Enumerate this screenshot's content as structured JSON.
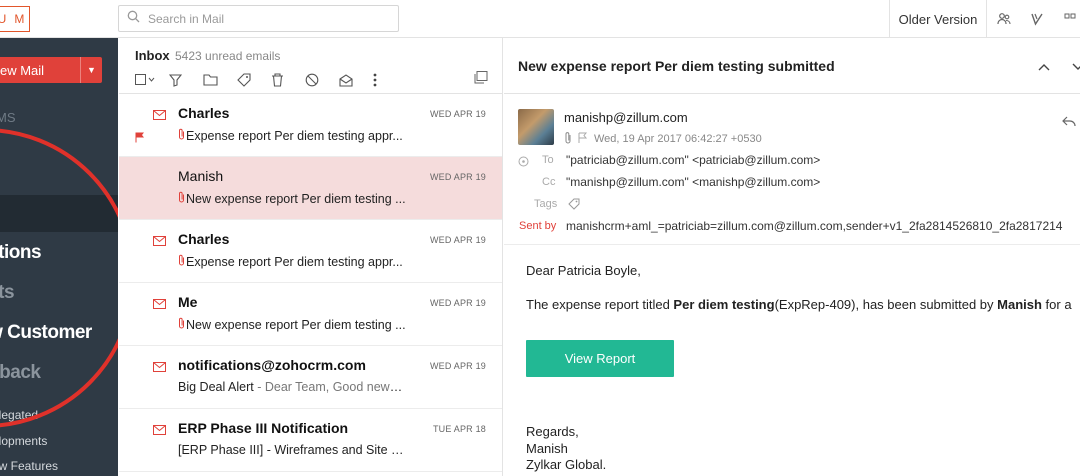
{
  "topbar": {
    "logo_letters": [
      "U",
      "M"
    ],
    "search_placeholder": "Search in Mail",
    "older_version": "Older Version"
  },
  "sidebar": {
    "new_mail": "ew Mail",
    "faded_item": "MS",
    "big_items": [
      "cations",
      "ects",
      "ew Customer",
      "edback"
    ],
    "small_items": [
      "elegated",
      "elopments",
      "ew Features"
    ]
  },
  "list": {
    "title": "Inbox",
    "unread": "5423 unread emails",
    "rows": [
      {
        "from": "Charles",
        "date": "WED APR 19",
        "subject": "Expense report Per diem testing appr...",
        "preview": "",
        "clip": true,
        "flag": true,
        "selected": false,
        "read": false
      },
      {
        "from": "Manish",
        "date": "WED APR 19",
        "subject": "New expense report Per diem testing ...",
        "preview": "",
        "clip": true,
        "flag": false,
        "selected": true,
        "read": true
      },
      {
        "from": "Charles",
        "date": "WED APR 19",
        "subject": "Expense report Per diem testing appr...",
        "preview": "",
        "clip": true,
        "flag": false,
        "selected": false,
        "read": false
      },
      {
        "from": "Me",
        "date": "WED APR 19",
        "subject": "New expense report Per diem testing ...",
        "preview": "",
        "clip": true,
        "flag": false,
        "selected": false,
        "read": false
      },
      {
        "from": "notifications@zohocrm.com",
        "date": "WED APR 19",
        "subject": "Big Deal Alert",
        "preview": " - Dear Team, Good news ...",
        "clip": false,
        "flag": false,
        "selected": false,
        "read": false
      },
      {
        "from": "ERP Phase III Notification",
        "date": "TUE APR 18",
        "subject": "[ERP Phase III] - Wireframes and Site E...",
        "preview": "",
        "clip": false,
        "flag": false,
        "selected": false,
        "read": false
      }
    ]
  },
  "pane": {
    "title": "New expense report Per diem testing submitted",
    "sender": "manishp@zillum.com",
    "date": "Wed, 19 Apr 2017 06:42:27 +0530",
    "to_label": "To",
    "to_value": "\"patriciab@zillum.com\" <patriciab@zillum.com>",
    "cc_label": "Cc",
    "cc_value": "\"manishp@zillum.com\" <manishp@zillum.com>",
    "tags_label": "Tags",
    "sentby_label": "Sent by",
    "sentby_value": "manishcrm+aml_=patriciab=zillum.com@zillum.com,sender+v1_2fa2814526810_2fa2817214",
    "greeting": "Dear Patricia Boyle,",
    "body_pre": "The expense report titled ",
    "body_bold1": "Per diem testing",
    "body_mid": "(ExpRep-409), has been submitted by ",
    "body_bold2": "Manish",
    "body_post": " for a",
    "button": "View Report",
    "regards": "Regards,",
    "sig_name": "Manish",
    "sig_company": "Zylkar Global."
  }
}
